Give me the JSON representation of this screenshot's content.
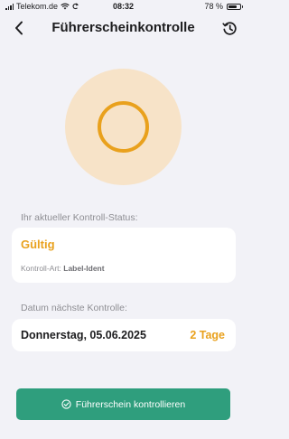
{
  "status_bar": {
    "carrier": "Telekom.de",
    "time": "08:32",
    "battery": "78 %",
    "battery_level": 0.78
  },
  "nav": {
    "title": "Führerscheinkontrolle",
    "back_icon": "chevron-left-icon",
    "history_icon": "history-clock-icon"
  },
  "status_section": {
    "label": "Ihr aktueller Kontroll-Status:",
    "status": "Gültig",
    "kontroll_art_label": "Kontroll-Art:",
    "kontroll_art_value": "Label-Ident"
  },
  "next_check_section": {
    "label": "Datum nächste Kontrolle:",
    "date": "Donnerstag, 05.06.2025",
    "days_left": "2 Tage"
  },
  "action": {
    "label": "Führerschein kontrollieren",
    "icon": "check-circle-icon"
  },
  "colors": {
    "accent_orange": "#e9a11d",
    "circle_bg": "#f7e3c8",
    "button_green": "#2f9e7d",
    "page_bg": "#f2f2f7"
  }
}
